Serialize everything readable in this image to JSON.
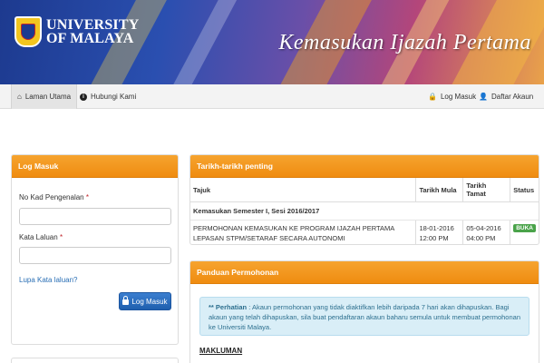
{
  "banner": {
    "logo_line1": "UNIVERSITY",
    "logo_line2": "OF MALAYA",
    "title": "Kemasukan Ijazah Pertama"
  },
  "nav": {
    "home": "Laman Utama",
    "contact": "Hubungi Kami",
    "login": "Log Masuk",
    "register": "Daftar Akaun"
  },
  "login_panel": {
    "title": "Log Masuk",
    "ic_label": "No Kad Pengenalan",
    "password_label": "Kata Laluan",
    "required_mark": "*",
    "forgot": "Lupa Kata laluan?",
    "submit": "Log Masuk"
  },
  "dates_panel": {
    "title": "Tarikh-tarikh penting",
    "headers": [
      "Tajuk",
      "Tarikh Mula",
      "Tarikh Tamat",
      "Status"
    ],
    "group": "Kemasukan Semester I, Sesi 2016/2017",
    "row": {
      "title": "PERMOHONAN KEMASUKAN KE PROGRAM IJAZAH PERTAMA LEPASAN STPM/SETARAF SECARA AUTONOMI",
      "start_date": "18-01-2016",
      "start_time": "12:00 PM",
      "end_date": "05-04-2016",
      "end_time": "04:00 PM",
      "status": "BUKA"
    }
  },
  "guide_panel": {
    "title": "Panduan Permohonan",
    "alert_prefix": "** Perhatian",
    "alert_text": ": Akaun permohonan yang tidak diaktifkan lebih daripada 7 hari akan dihapuskan. Bagi akaun yang telah dihapuskan, sila buat pendaftaran akaun baharu semula untuk membuat permohonan ke Universiti Malaya.",
    "makluman": "MAKLUMAN"
  },
  "colors": {
    "accent_orange": "#ef8c10",
    "button_blue": "#1f5fae",
    "status_green": "#4aa34a"
  }
}
